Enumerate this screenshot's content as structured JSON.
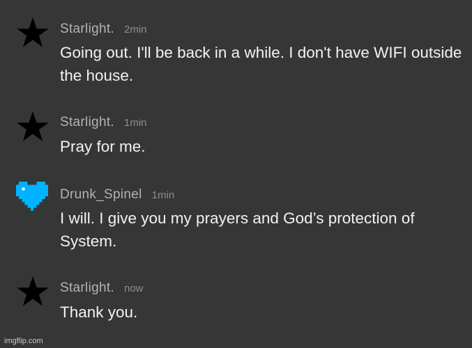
{
  "messages": [
    {
      "username": "Starlight.",
      "time": "2min",
      "avatar_icon": "star-icon",
      "text": "Going out. I'll be back in a while. I don't have WIFI outside the house."
    },
    {
      "username": "Starlight.",
      "time": "1min",
      "avatar_icon": "star-icon",
      "text": "Pray for me."
    },
    {
      "username": "Drunk_Spinel",
      "time": "1min",
      "avatar_icon": "pixel-heart-icon",
      "text": "I will. I give you my prayers and God’s protection of System."
    },
    {
      "username": "Starlight.",
      "time": "now",
      "avatar_icon": "star-icon",
      "text": "Thank you."
    }
  ],
  "colors": {
    "background": "#363636",
    "star": "#000000",
    "heart": "#00b2ff",
    "username": "#b3b3b3",
    "timestamp": "#8e8e8e",
    "message_text": "#f2f2f2"
  },
  "watermark": "imgflip.com"
}
